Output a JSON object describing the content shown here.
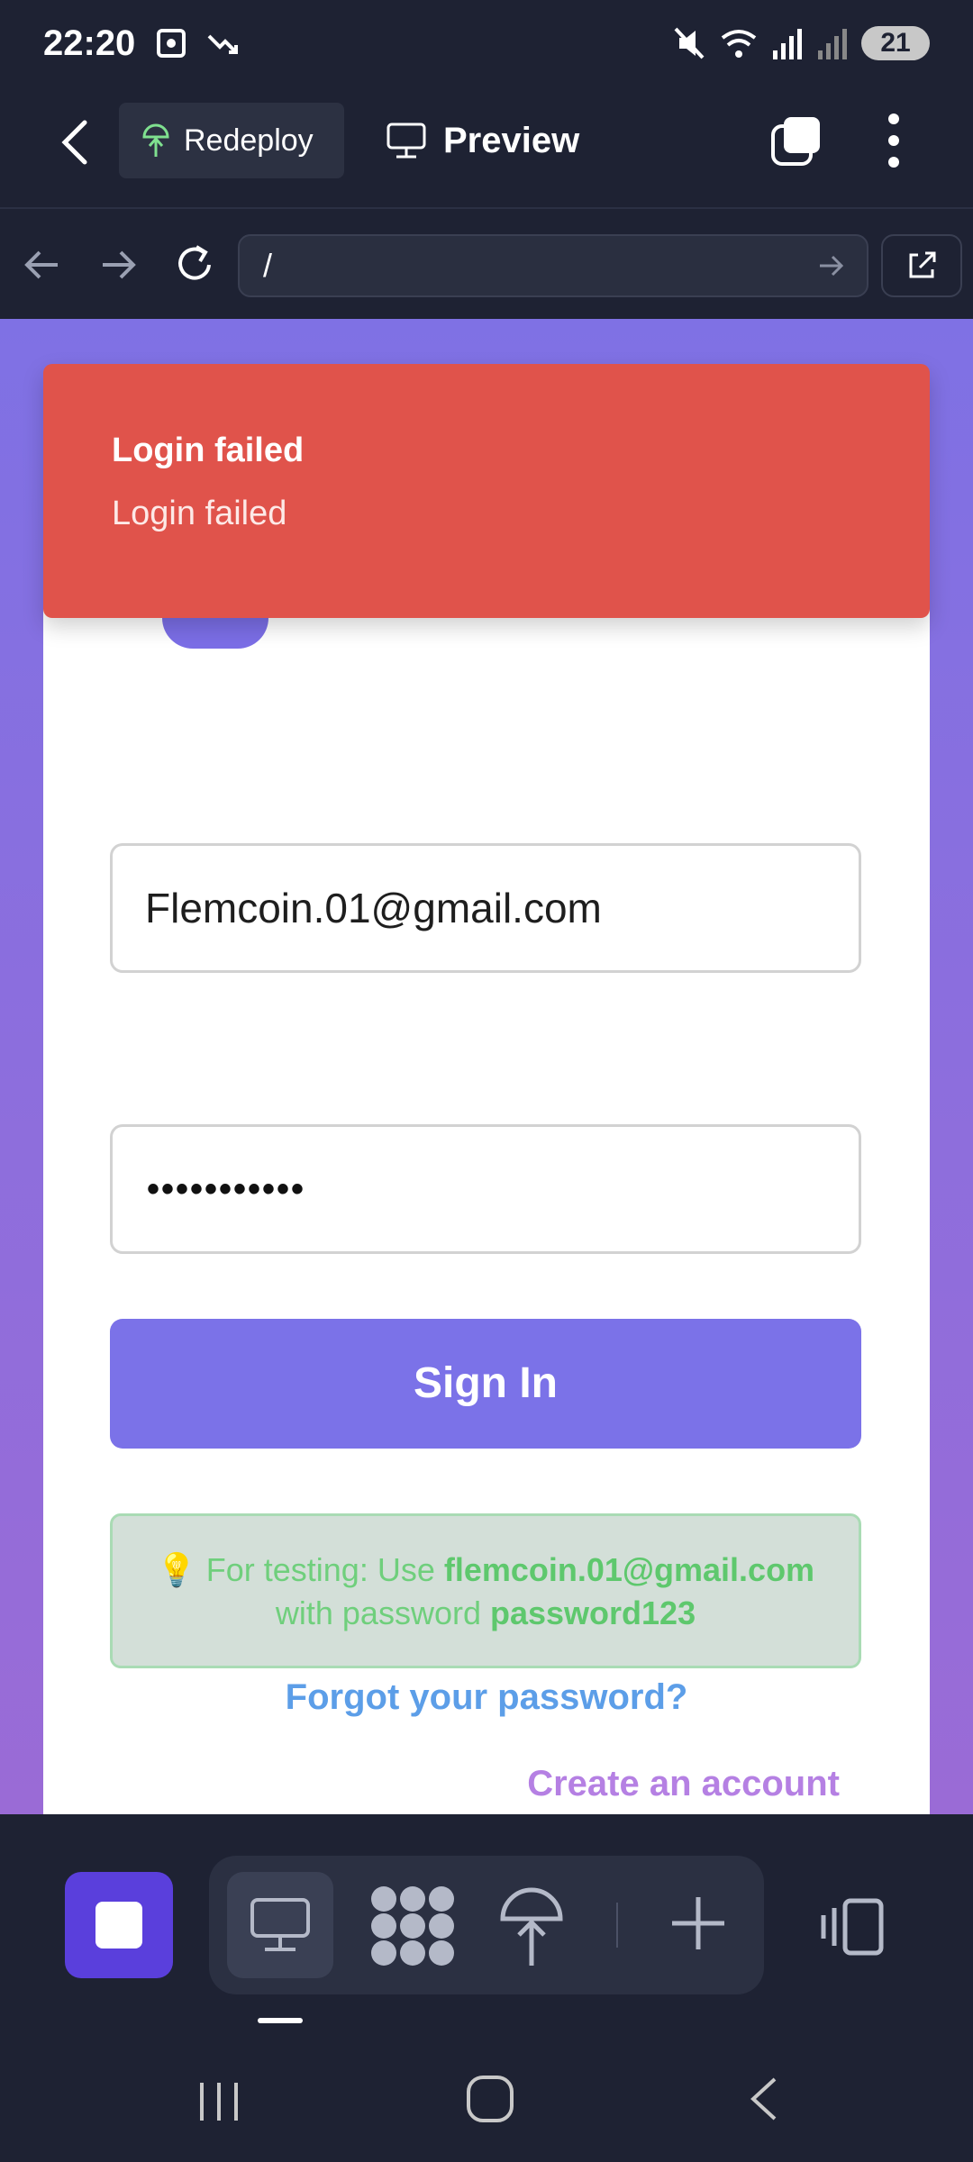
{
  "status_bar": {
    "time": "22:20",
    "battery": "21"
  },
  "app_header": {
    "redeploy_label": "Redeploy",
    "preview_label": "Preview"
  },
  "url_bar": {
    "value": "/"
  },
  "toast": {
    "title": "Login failed",
    "message": "Login failed"
  },
  "login_form": {
    "email_value": "Flemcoin.01@gmail.com",
    "password_masked": "•••••••••••",
    "sign_in_label": "Sign In",
    "hint": {
      "emoji": "💡",
      "prefix": "For testing: Use ",
      "email": "flemcoin.01@gmail.com",
      "middle": "with password ",
      "password": "password123"
    },
    "forgot_link": "Forgot your password?",
    "create_link": "Create an account"
  },
  "colors": {
    "accent": "#7b72e8",
    "error": "#e0534b",
    "success_text": "#6fcf7c",
    "link_blue": "#5c9ee8",
    "link_purple": "#b580e3"
  }
}
